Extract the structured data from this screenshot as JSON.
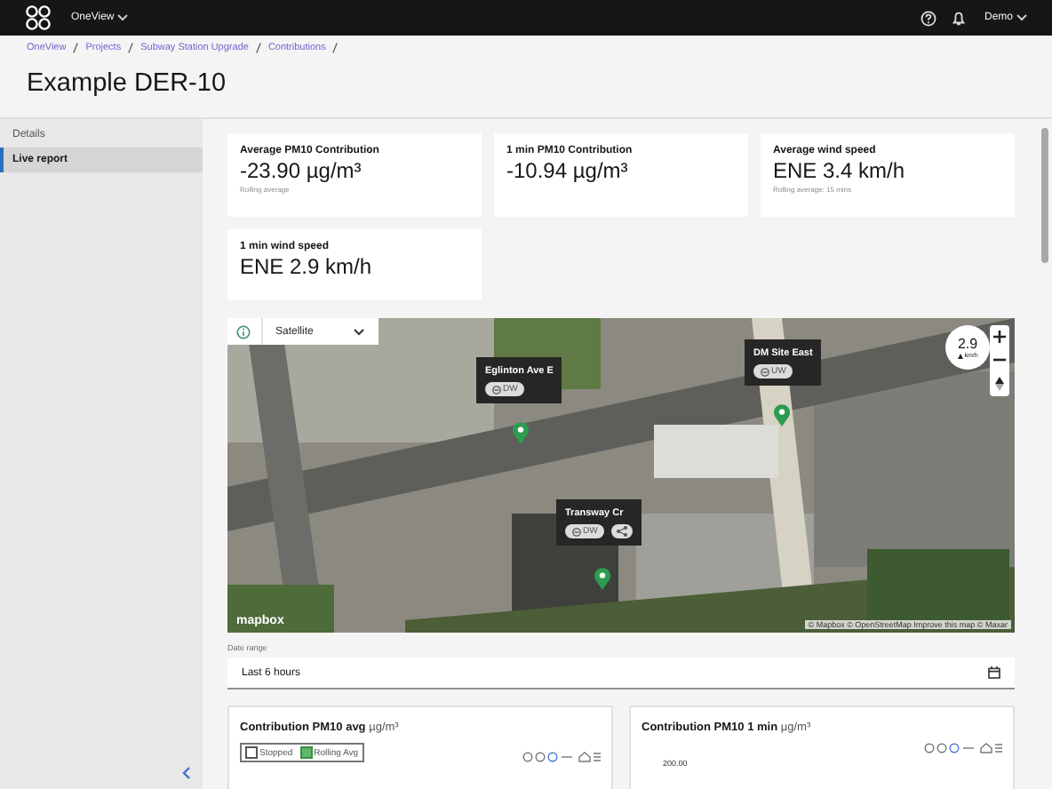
{
  "header": {
    "app": "OneView",
    "user": "Demo"
  },
  "breadcrumbs": [
    "OneView",
    "Projects",
    "Subway Station Upgrade",
    "Contributions"
  ],
  "title": "Example DER-10",
  "sidebar": {
    "items": [
      {
        "label": "Details",
        "selected": false
      },
      {
        "label": "Live report",
        "selected": true
      }
    ]
  },
  "metrics": [
    {
      "label": "Average PM10 Contribution",
      "value": "-23.90 µg/m³",
      "note": "Rolling average"
    },
    {
      "label": "1 min PM10 Contribution",
      "value": "-10.94 µg/m³"
    },
    {
      "label": "Average wind speed",
      "value": "ENE 3.4 km/h",
      "note": "Rolling average: 15 mins"
    },
    {
      "label": "1 min wind speed",
      "value": "ENE 2.9 km/h"
    }
  ],
  "map": {
    "layer": "Satellite",
    "wind": {
      "speed": "2.9",
      "unit": "km/h"
    },
    "stations": [
      {
        "name": "Eglinton Ave E",
        "chips": [
          {
            "kind": "label",
            "label": "DW"
          }
        ]
      },
      {
        "name": "DM Site East",
        "chips": [
          {
            "kind": "label",
            "label": "UW"
          }
        ]
      },
      {
        "name": "Transway Cr",
        "chips": [
          {
            "kind": "label",
            "label": "DW"
          },
          {
            "kind": "icon"
          }
        ]
      }
    ],
    "logo": "mapbox",
    "attribution": "© Mapbox © OpenStreetMap Improve this map © Maxar"
  },
  "date_range": {
    "label": "Date range",
    "value": "Last 6 hours"
  },
  "charts": [
    {
      "title": "Contribution PM10 avg",
      "unit": "µg/m³",
      "legend": [
        {
          "label": "Stopped",
          "checked": false
        },
        {
          "label": "Rolling Avg",
          "checked": true
        }
      ]
    },
    {
      "title": "Contribution PM10 1 min",
      "unit": "µg/m³",
      "ytick": "200.00"
    }
  ]
}
